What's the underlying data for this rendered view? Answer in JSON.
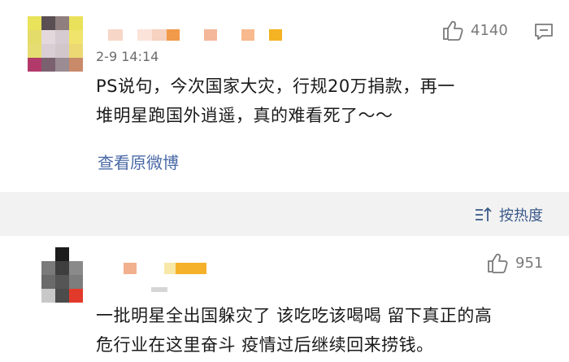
{
  "comment1": {
    "time": "2-9 14:14",
    "likes": "4140",
    "text_line1": "PS说句，今次国家大灾，行规20万捐款，再一",
    "text_line2": "堆明星跑国外逍遥，真的难看死了～～",
    "view_original": "查看原微博"
  },
  "sort": {
    "label": "按热度"
  },
  "comment2": {
    "likes": "951",
    "text_line1": "一批明星全出国躲灾了 该吃吃该喝喝 留下真正的高",
    "text_line2": "危行业在这里奋斗 疫情过后继续回来捞钱。"
  },
  "colors": {
    "link": "#4a6aa6",
    "band": "#f2f2f2"
  }
}
